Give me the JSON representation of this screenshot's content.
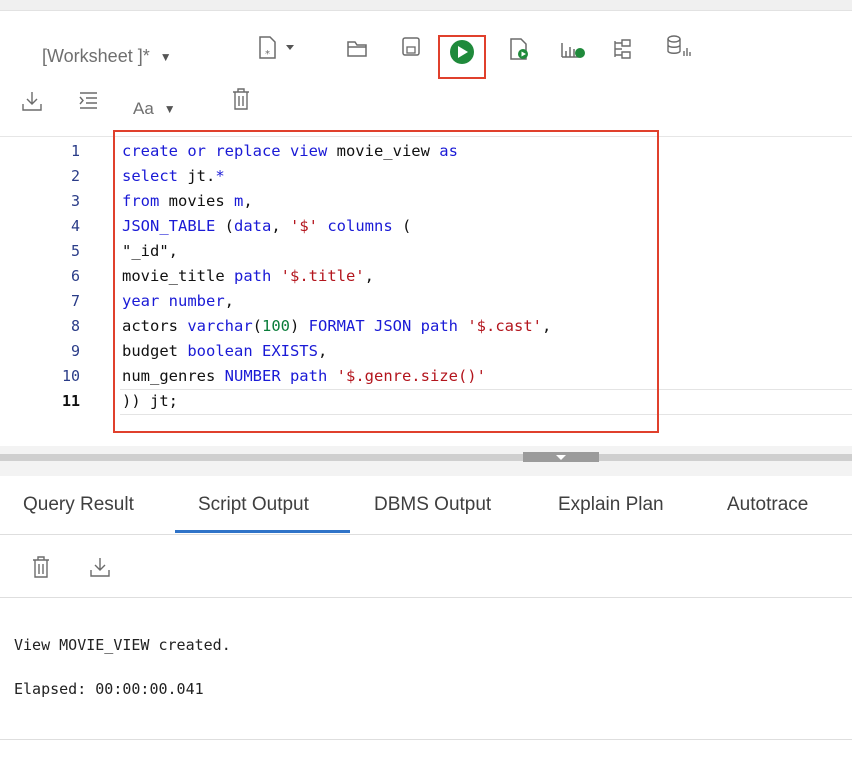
{
  "toolbar": {
    "worksheet_label": "[Worksheet ]*",
    "font_label": "Aa",
    "icons": [
      "new-file-icon",
      "open-folder-icon",
      "save-icon",
      "run-statement-icon",
      "run-script-icon",
      "explain-plan-icon",
      "autotrace-icon",
      "tree-icon",
      "sql-tuning-icon",
      "download-icon",
      "format-icon",
      "font-icon",
      "trash-icon"
    ]
  },
  "editor": {
    "line_numbers": [
      "1",
      "2",
      "3",
      "4",
      "5",
      "6",
      "7",
      "8",
      "9",
      "10",
      "11"
    ]
  },
  "tabs": {
    "query_result": "Query Result",
    "script_output": "Script Output",
    "dbms_output": "DBMS Output",
    "explain_plan": "Explain Plan",
    "autotrace": "Autotrace"
  },
  "output": {
    "line1": "View MOVIE_VIEW created.",
    "line2": "Elapsed: 00:00:00.041"
  },
  "code_tokens": {
    "l1": [
      "create or replace view",
      " movie_view ",
      "as"
    ],
    "l2": [
      "select",
      " jt.",
      "*"
    ],
    "l3": [
      "from",
      " movies ",
      "m",
      ","
    ],
    "l4": [
      "JSON_TABLE",
      " (",
      "data",
      ", ",
      "'$'",
      " ",
      "columns",
      " ("
    ],
    "l5": [
      "\"_id\","
    ],
    "l6": [
      "movie_title ",
      "path",
      " ",
      "'$.title'",
      ","
    ],
    "l7": [
      "year",
      " ",
      "number",
      ","
    ],
    "l8": [
      "actors ",
      "varchar",
      "(",
      "100",
      ") ",
      "FORMAT JSON path",
      " ",
      "'$.cast'",
      ","
    ],
    "l9": [
      "budget ",
      "boolean EXISTS",
      ","
    ],
    "l10": [
      "num_genres ",
      "NUMBER path",
      " ",
      "'$.genre.size()'"
    ],
    "l11": [
      ")) jt;"
    ]
  },
  "colors": {
    "highlight": "#e0402c",
    "run_green": "#1f8a3b",
    "tab_active": "#2f73c8"
  }
}
